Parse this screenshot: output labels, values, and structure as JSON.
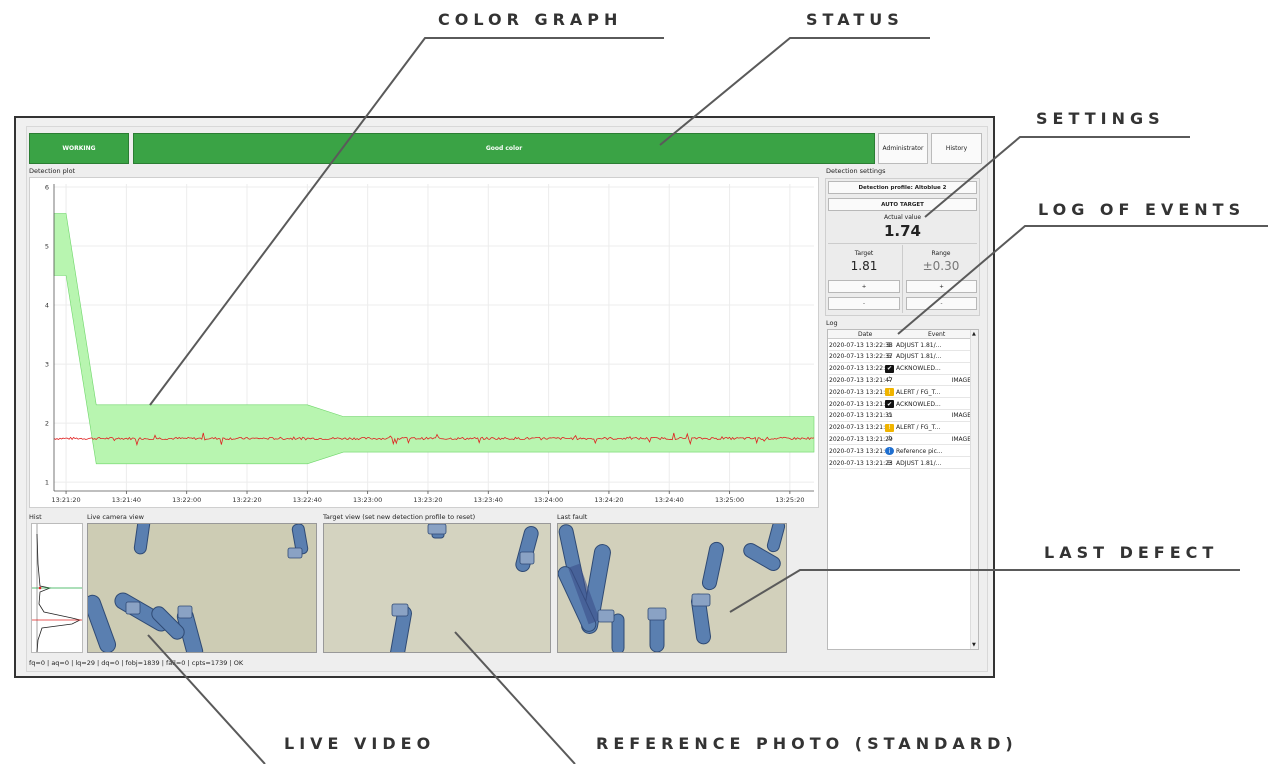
{
  "callouts": {
    "color_graph": "COLOR GRAPH",
    "status": "STATUS",
    "settings": "SETTINGS",
    "log_of_events": "LOG OF EVENTS",
    "last_defect": "LAST DEFECT",
    "live_video": "LIVE VIDEO",
    "reference_photo": "REFERENCE PHOTO (STANDARD)"
  },
  "topbar": {
    "working": "WORKING",
    "status_text": "Good color",
    "administrator": "Administrator",
    "history": "History",
    "status_color": "#3aa345"
  },
  "plot": {
    "label": "Detection plot",
    "band_color": "#b8f5b0",
    "line_color": "#e02020"
  },
  "chart_data": {
    "type": "line",
    "x": [
      "13:21:20",
      "13:21:40",
      "13:22:00",
      "13:22:20",
      "13:22:40",
      "13:23:00",
      "13:23:20",
      "13:23:40",
      "13:24:00",
      "13:24:20",
      "13:24:40",
      "13:25:00",
      "13:25:20"
    ],
    "y_ticks": [
      1,
      2,
      3,
      4,
      5,
      6
    ],
    "ylim": [
      0.85,
      6.05
    ],
    "xlim_seconds": [
      -4,
      248
    ],
    "band": {
      "t": [
        -4,
        0,
        0,
        10,
        80,
        80,
        92,
        92,
        248
      ],
      "upper": [
        5.55,
        5.55,
        5.55,
        2.31,
        2.31,
        2.31,
        2.11,
        2.11,
        2.11
      ],
      "lower": [
        4.5,
        4.5,
        4.5,
        1.31,
        1.31,
        1.31,
        1.51,
        1.51,
        1.51
      ]
    },
    "series": [
      {
        "values_mean": 1.74,
        "target": 1.81,
        "range": 0.3
      }
    ],
    "grid": true
  },
  "detection_settings": {
    "label": "Detection settings",
    "profile_button": "Detection profile: Altoblue 2",
    "auto_target": "AUTO TARGET",
    "actual_label": "Actual value",
    "actual_value": "1.74",
    "target_label": "Target",
    "target_value": "1.81",
    "range_label": "Range",
    "range_value": "±0.30",
    "plus": "+",
    "minus": "-"
  },
  "log": {
    "label": "Log",
    "col_date": "Date",
    "col_event": "Event",
    "rows": [
      {
        "date": "2020-07-13 13:22:38",
        "icon": "sliders-icon",
        "event": "ADJUST 1.81/..."
      },
      {
        "date": "2020-07-13 13:22:37",
        "icon": "sliders-icon",
        "event": "ADJUST 1.81/..."
      },
      {
        "date": "2020-07-13 13:22:02",
        "icon": "check-icon",
        "event": "ACKNOWLED..."
      },
      {
        "date": "2020-07-13 13:21:47",
        "icon": "power-icon",
        "event": "IMAGE"
      },
      {
        "date": "2020-07-13 13:21:47",
        "icon": "warning-icon",
        "event": "ALERT / FG_T..."
      },
      {
        "date": "2020-07-13 13:21:35",
        "icon": "check-icon",
        "event": "ACKNOWLED..."
      },
      {
        "date": "2020-07-13 13:21:31",
        "icon": "power-icon",
        "event": "IMAGE"
      },
      {
        "date": "2020-07-13 13:21:31",
        "icon": "warning-icon",
        "event": "ALERT / FG_T..."
      },
      {
        "date": "2020-07-13 13:21:29",
        "icon": "power-icon",
        "event": "IMAGE"
      },
      {
        "date": "2020-07-13 13:21:29",
        "icon": "info-icon",
        "event": "Reference pic..."
      },
      {
        "date": "2020-07-13 13:21:23",
        "icon": "sliders-icon",
        "event": "ADJUST 1.81/..."
      }
    ]
  },
  "panels": {
    "hist": "Hist",
    "live": "Live camera view",
    "target": "Target view (set new detection profile to reset)",
    "last_fault": "Last fault"
  },
  "statusline": "fq=0 | aq=0 | lq=29 | dq=0 | fobj=1839 | fail=0 | cpts=1739 | OK"
}
